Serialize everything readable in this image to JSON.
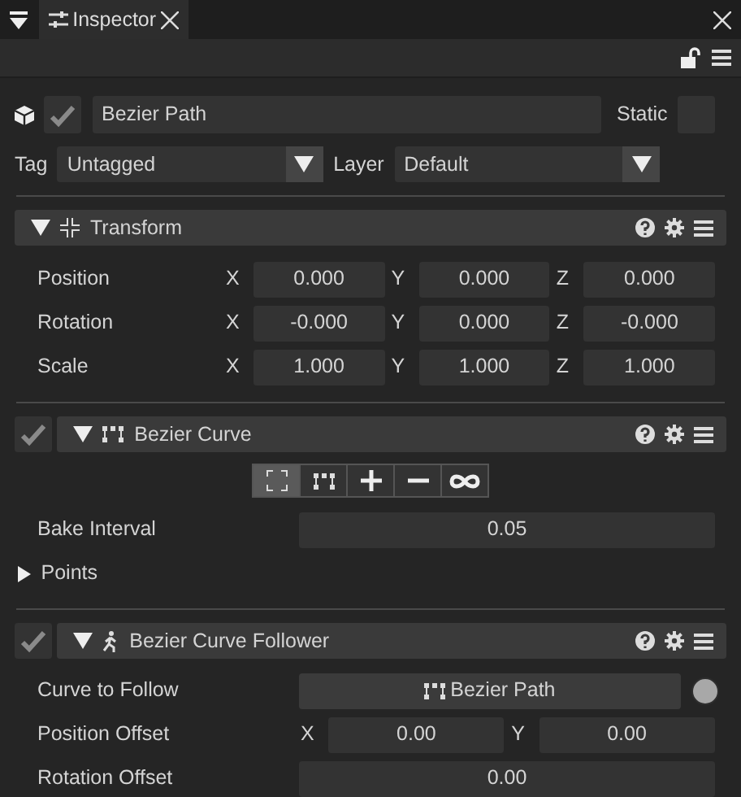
{
  "tab": {
    "title": "Inspector",
    "selected": true
  },
  "object": {
    "active": true,
    "name": "Bezier Path",
    "static_label": "Static",
    "static": false,
    "tag_label": "Tag",
    "tag": "Untagged",
    "layer_label": "Layer",
    "layer": "Default"
  },
  "components": [
    {
      "kind": "transform",
      "title": "Transform",
      "expanded": true,
      "rows": [
        {
          "kind": "vector3",
          "label": "Position",
          "fields": [
            {
              "axis": "X",
              "value": "0.000"
            },
            {
              "axis": "Y",
              "value": "0.000"
            },
            {
              "axis": "Z",
              "value": "0.000"
            }
          ]
        },
        {
          "kind": "vector3",
          "label": "Rotation",
          "fields": [
            {
              "axis": "X",
              "value": "-0.000"
            },
            {
              "axis": "Y",
              "value": "0.000"
            },
            {
              "axis": "Z",
              "value": "-0.000"
            }
          ]
        },
        {
          "kind": "vector3",
          "label": "Scale",
          "fields": [
            {
              "axis": "X",
              "value": "1.000"
            },
            {
              "axis": "Y",
              "value": "1.000"
            },
            {
              "axis": "Z",
              "value": "1.000"
            }
          ]
        }
      ]
    },
    {
      "kind": "curve",
      "title": "Bezier Curve",
      "enabled": true,
      "expanded": true,
      "tools": [
        {
          "kind": "frame",
          "selected": true
        },
        {
          "kind": "nodes",
          "selected": false
        },
        {
          "kind": "add",
          "selected": false
        },
        {
          "kind": "remove",
          "selected": false
        },
        {
          "kind": "loop",
          "selected": false
        }
      ],
      "rows": [
        {
          "kind": "float",
          "label": "Bake Interval",
          "value": "0.05"
        },
        {
          "kind": "foldout",
          "label": "Points",
          "expanded": false
        }
      ]
    },
    {
      "kind": "follower",
      "title": "Bezier Curve Follower",
      "enabled": true,
      "expanded": true,
      "rows": [
        {
          "kind": "object",
          "label": "Curve to Follow",
          "value": "Bezier Path"
        },
        {
          "kind": "vector2",
          "label": "Position Offset",
          "fields": [
            {
              "axis": "X",
              "value": "0.00"
            },
            {
              "axis": "Y",
              "value": "0.00"
            }
          ]
        },
        {
          "kind": "float",
          "label": "Rotation Offset",
          "value": "0.00"
        }
      ]
    }
  ]
}
